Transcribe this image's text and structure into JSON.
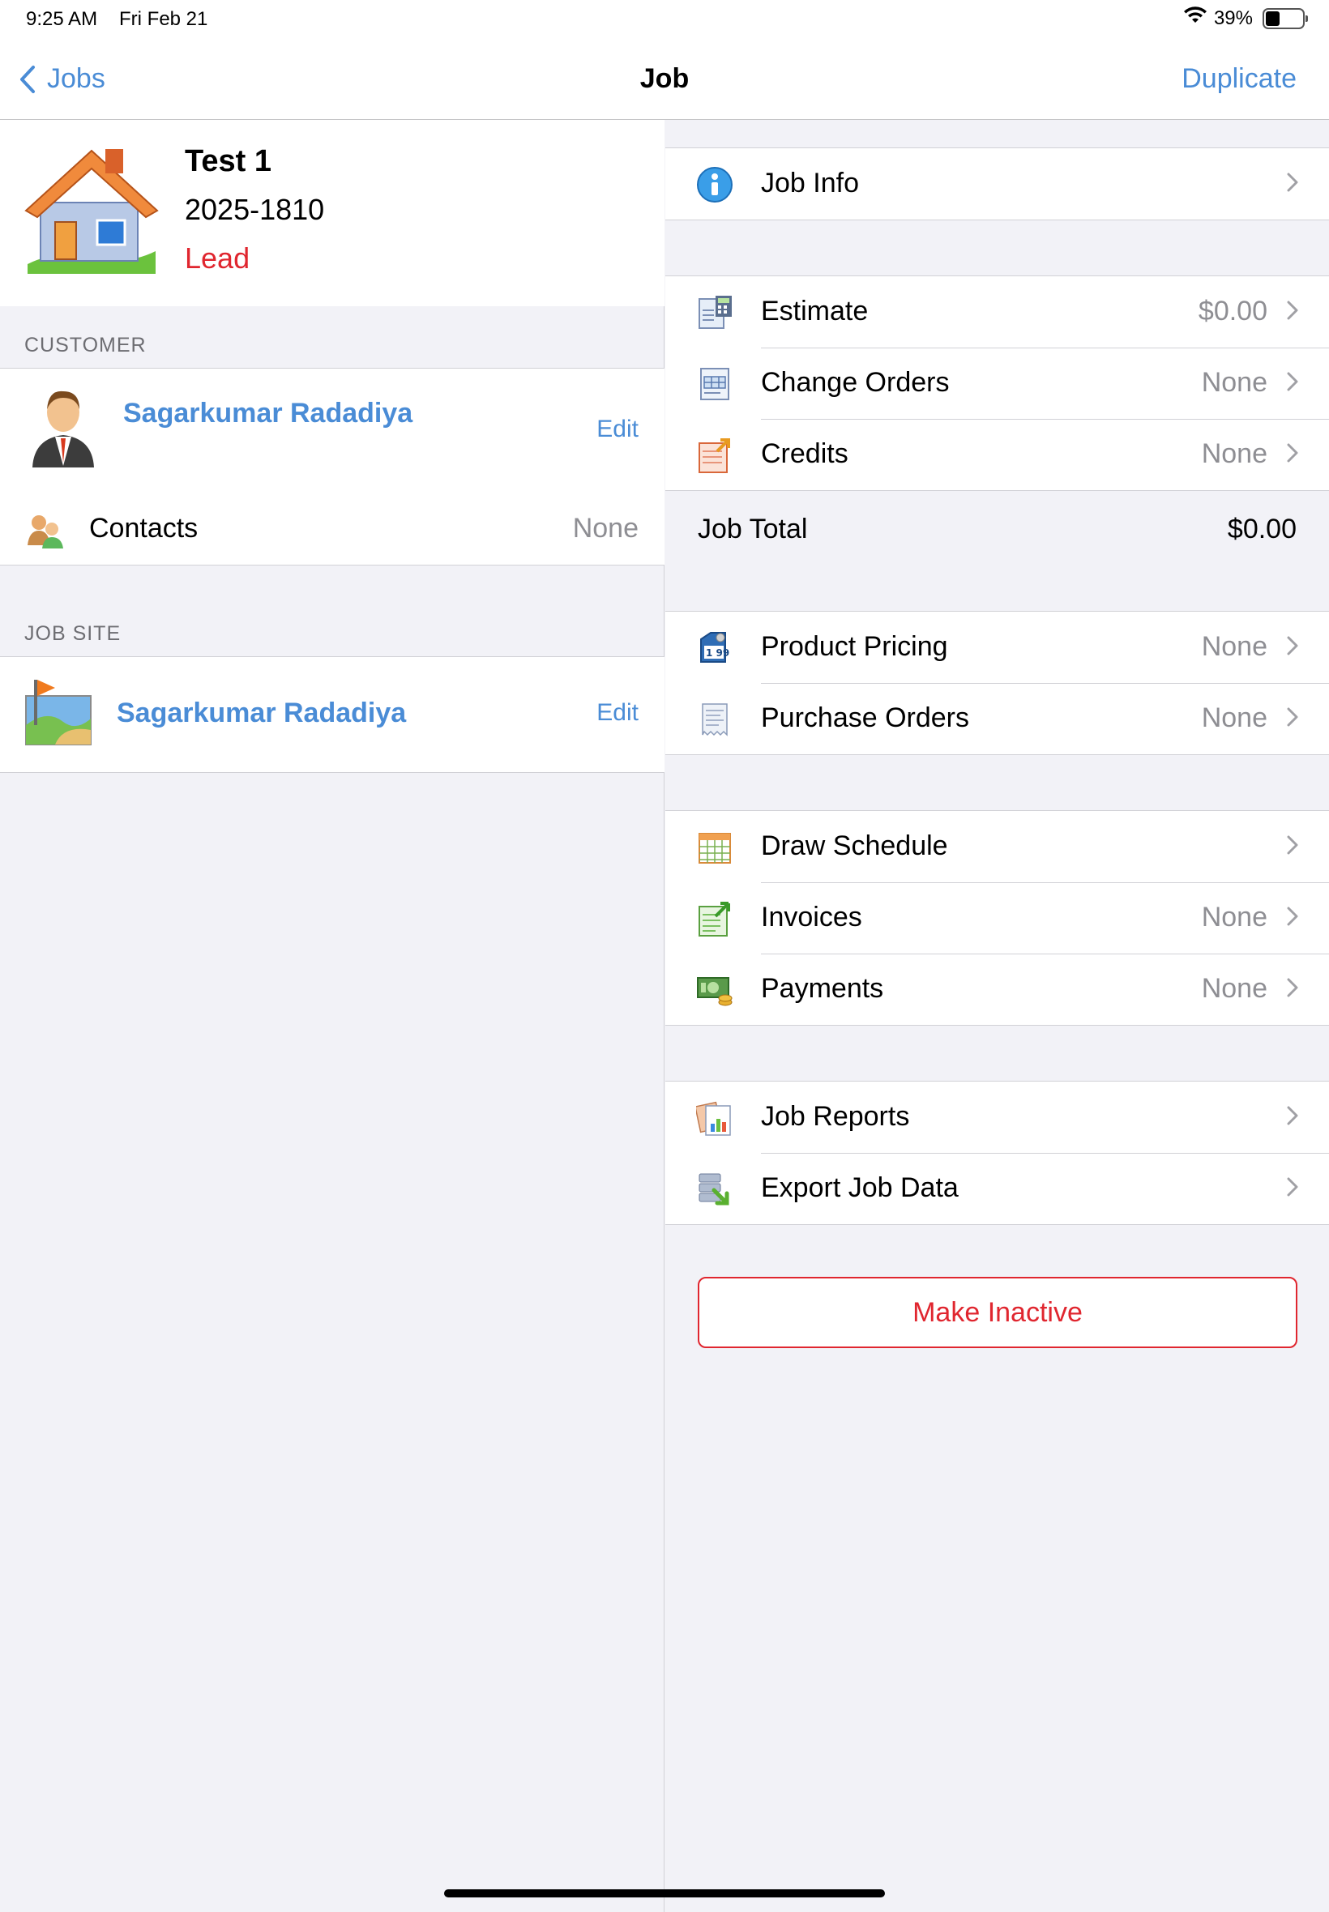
{
  "status_bar": {
    "time": "9:25 AM",
    "date": "Fri Feb 21",
    "battery": "39%",
    "battery_level": 0.39
  },
  "nav": {
    "back_label": "Jobs",
    "title": "Job",
    "duplicate_label": "Duplicate"
  },
  "job": {
    "title": "Test 1",
    "number": "2025-1810",
    "status": "Lead"
  },
  "customer": {
    "section_label": "CUSTOMER",
    "name": "Sagarkumar Radadiya",
    "edit_label": "Edit",
    "contacts_label": "Contacts",
    "contacts_value": "None"
  },
  "job_site": {
    "section_label": "JOB SITE",
    "name": "Sagarkumar Radadiya",
    "edit_label": "Edit"
  },
  "menu": {
    "job_info": {
      "label": "Job Info",
      "value": ""
    },
    "estimate": {
      "label": "Estimate",
      "value": "$0.00"
    },
    "change_orders": {
      "label": "Change Orders",
      "value": "None"
    },
    "credits": {
      "label": "Credits",
      "value": "None"
    },
    "job_total": {
      "label": "Job Total",
      "value": "$0.00"
    },
    "product_pricing": {
      "label": "Product Pricing",
      "value": "None"
    },
    "purchase_orders": {
      "label": "Purchase Orders",
      "value": "None"
    },
    "draw_schedule": {
      "label": "Draw Schedule",
      "value": ""
    },
    "invoices": {
      "label": "Invoices",
      "value": "None"
    },
    "payments": {
      "label": "Payments",
      "value": "None"
    },
    "job_reports": {
      "label": "Job Reports",
      "value": ""
    },
    "export_job_data": {
      "label": "Export Job Data",
      "value": ""
    }
  },
  "make_inactive_label": "Make Inactive",
  "colors": {
    "accent": "#4a8cd6",
    "danger": "#e0262f",
    "background": "#f2f2f7"
  },
  "icons": {
    "job_info": "info-icon",
    "estimate": "calculator-icon",
    "change_orders": "form-icon",
    "credits": "credit-note-icon",
    "product_pricing": "price-tag-icon",
    "purchase_orders": "receipt-icon",
    "draw_schedule": "calendar-icon",
    "invoices": "invoice-icon",
    "payments": "money-icon",
    "job_reports": "report-icon",
    "export_job_data": "export-icon"
  }
}
